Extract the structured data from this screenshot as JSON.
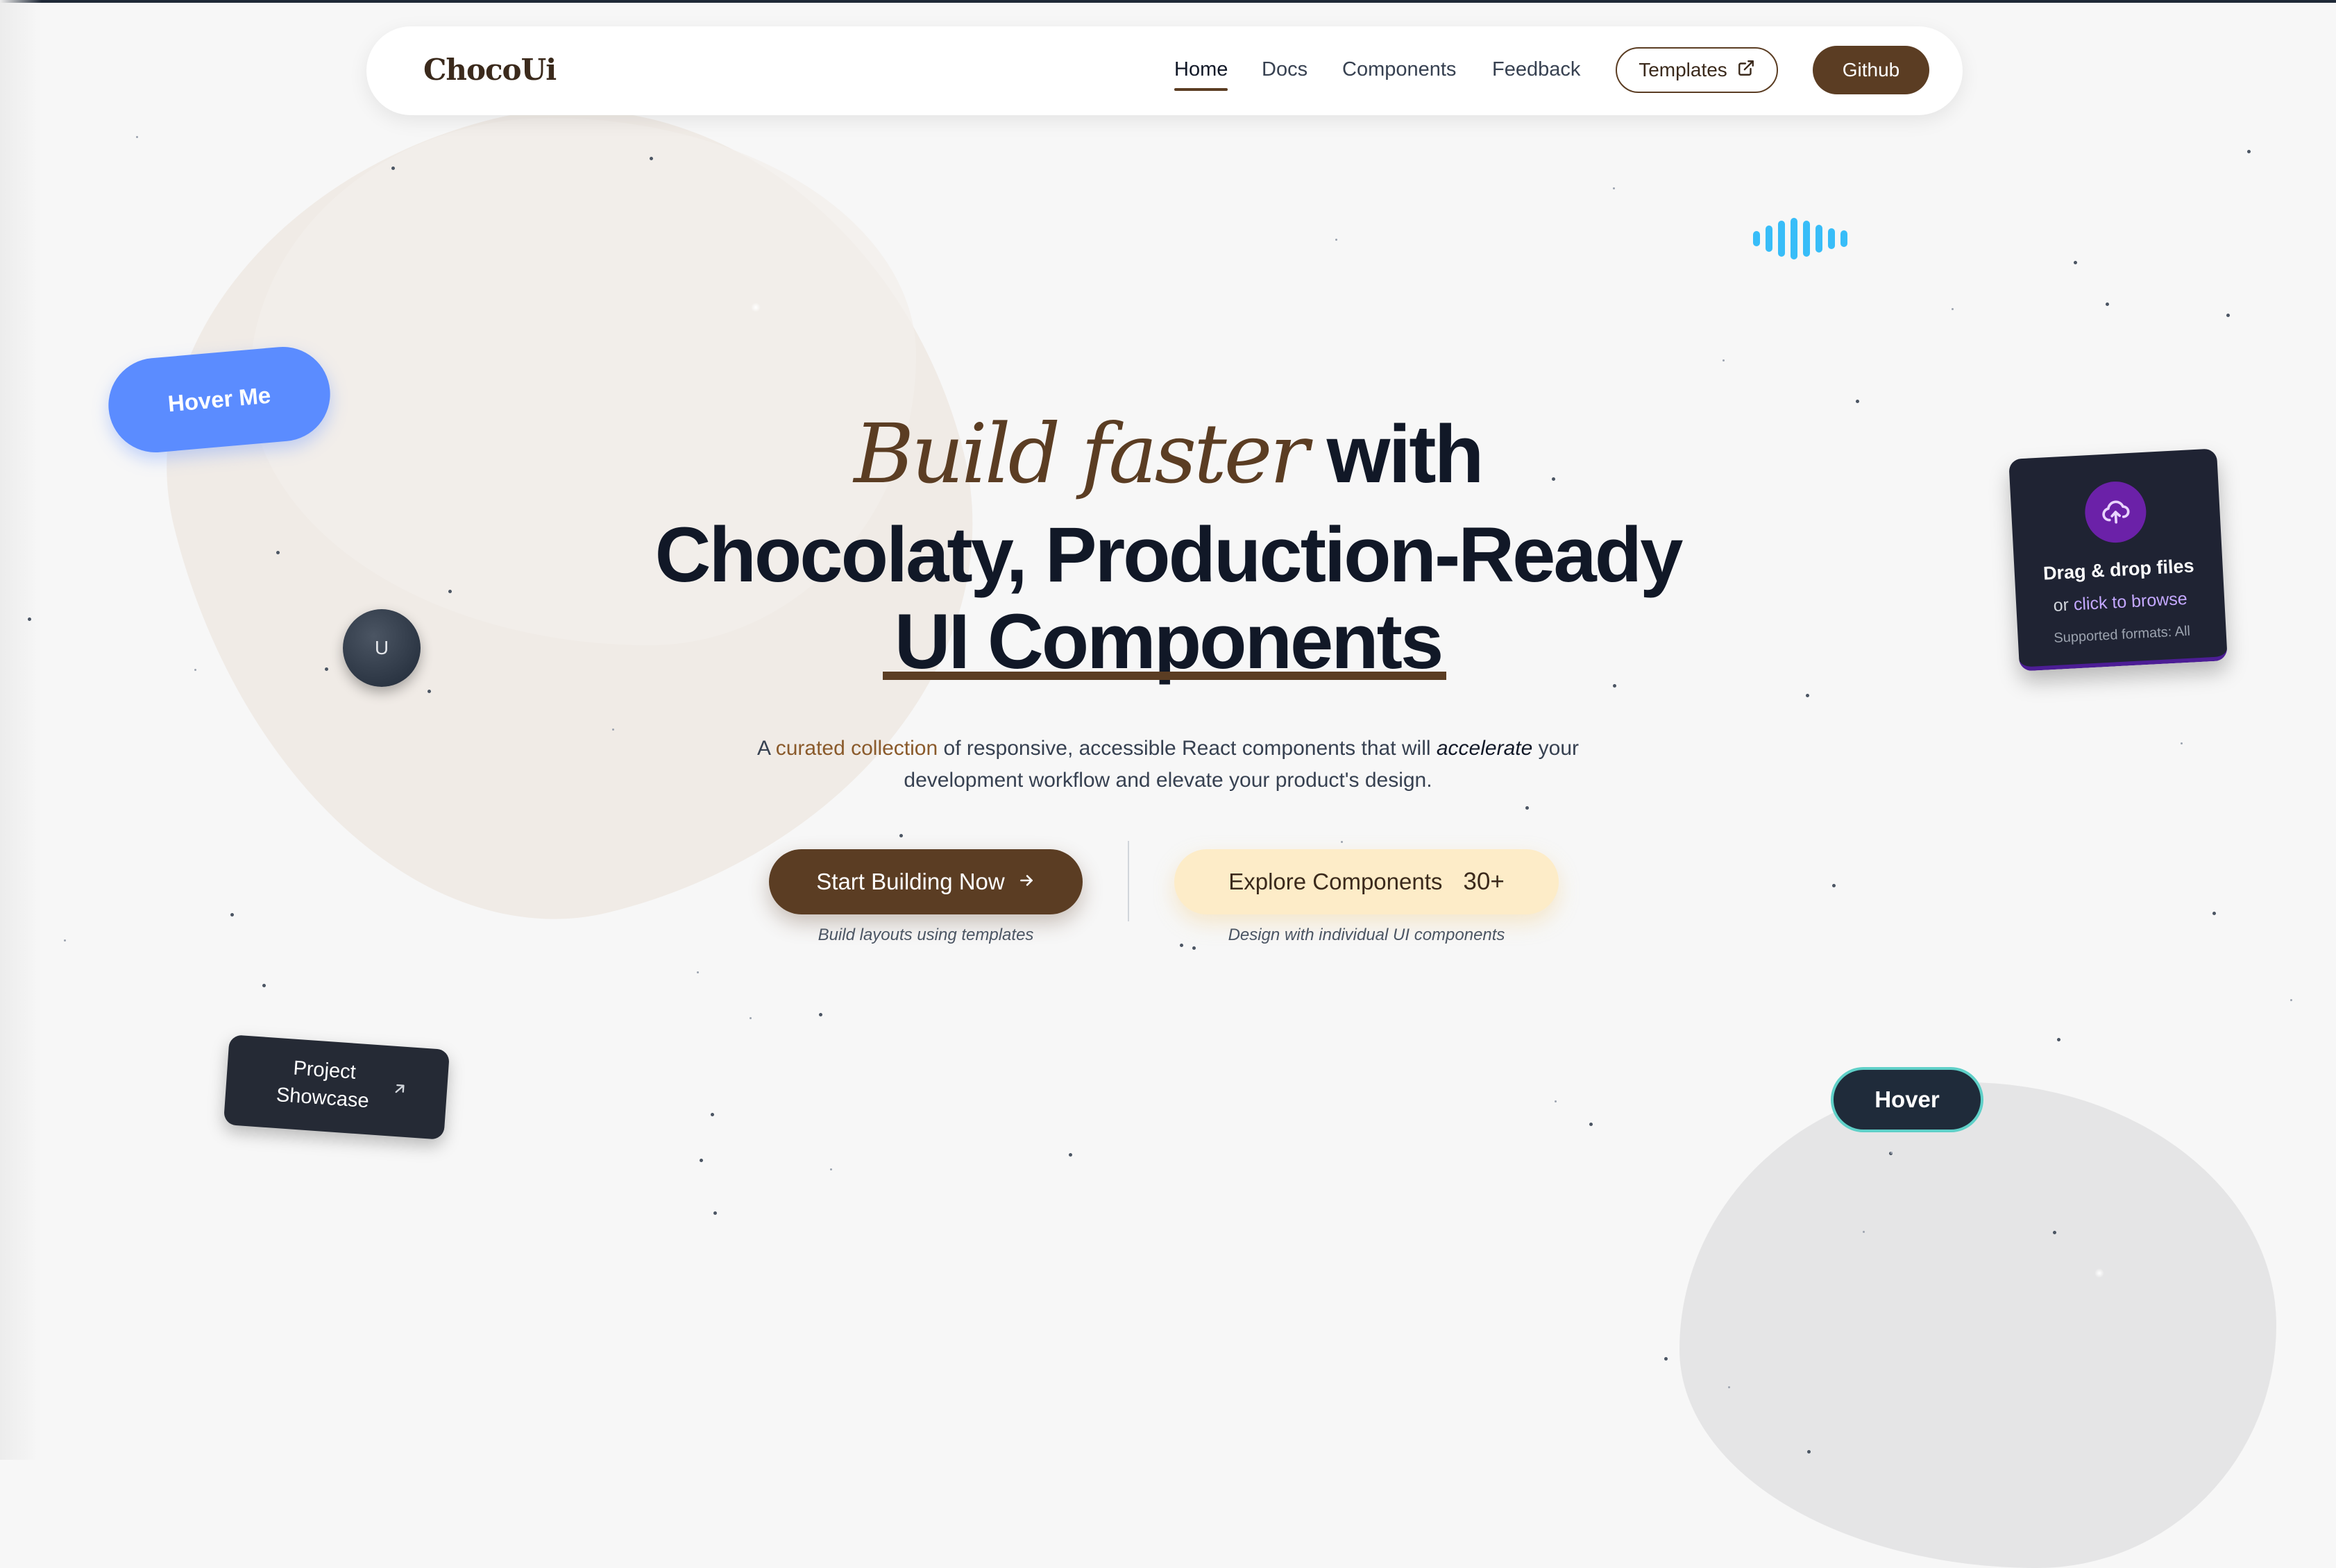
{
  "nav": {
    "logo": "ChocoUi",
    "links": [
      "Home",
      "Docs",
      "Components",
      "Feedback"
    ],
    "templates_label": "Templates",
    "github_label": "Github"
  },
  "hero": {
    "title_italic": "Build faster",
    "title_with": "with",
    "title_line2": "Chocolaty, Production-Ready",
    "title_line3": "UI Components",
    "subtitle": {
      "a": "A",
      "highlight": "curated collection",
      "mid": "of responsive, accessible React components that will",
      "emph": "accelerate",
      "end": "your development workflow and elevate your product's design."
    }
  },
  "cta": {
    "primary_label": "Start Building Now",
    "primary_caption": "Build layouts using templates",
    "secondary_label": "Explore Components",
    "secondary_count": "30+",
    "secondary_caption": "Design with individual UI components"
  },
  "widgets": {
    "hover_me": "Hover Me",
    "avatar_initial": "U",
    "showcase_line1": "Project",
    "showcase_line2": "Showcase",
    "dropzone_title": "Drag & drop files",
    "dropzone_or": "or",
    "dropzone_link": "click to browse",
    "dropzone_note": "Supported formats: All",
    "hover_label": "Hover"
  },
  "colors": {
    "brand_brown": "#5b3d23",
    "accent_cream": "#fdecc8",
    "hover_blue": "#5b8cff",
    "wave_cyan": "#38bdf8"
  }
}
